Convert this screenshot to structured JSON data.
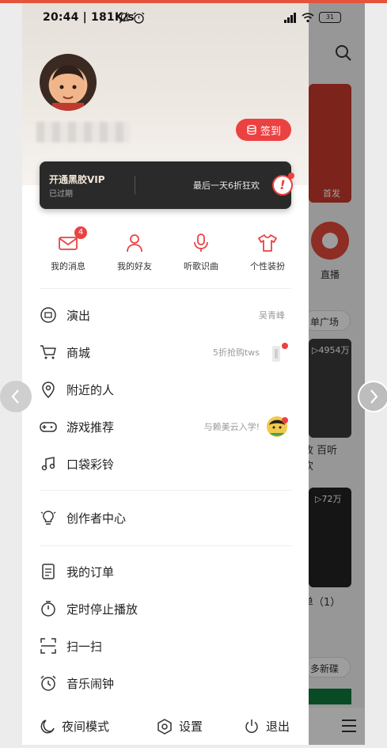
{
  "status_bar": {
    "time_speed": "20:44 | 181K/s",
    "battery": "31",
    "signal": "HD"
  },
  "profile": {
    "signin_label": "签到"
  },
  "vip": {
    "title": "开通黑胶VIP",
    "subtitle": "已过期",
    "promo": "最后一天6折狂欢",
    "badge": "!"
  },
  "quick_actions": [
    {
      "label": "我的消息",
      "icon": "mail-icon",
      "badge": "4"
    },
    {
      "label": "我的好友",
      "icon": "person-icon"
    },
    {
      "label": "听歌识曲",
      "icon": "mic-icon"
    },
    {
      "label": "个性装扮",
      "icon": "tshirt-icon"
    }
  ],
  "menu_group1": [
    {
      "label": "演出",
      "icon": "ticket-icon",
      "right": "吴青峰"
    },
    {
      "label": "商城",
      "icon": "cart-icon",
      "right": "5折抢购tws"
    },
    {
      "label": "附近的人",
      "icon": "location-icon",
      "right": ""
    },
    {
      "label": "游戏推荐",
      "icon": "gamepad-icon",
      "right": "与赖美云入学!"
    },
    {
      "label": "口袋彩铃",
      "icon": "ringtone-icon",
      "right": ""
    }
  ],
  "menu_group2": [
    {
      "label": "创作者中心",
      "icon": "bulb-icon"
    }
  ],
  "menu_group3": [
    {
      "label": "我的订单",
      "icon": "order-icon"
    },
    {
      "label": "定时停止播放",
      "icon": "timer-icon"
    },
    {
      "label": "扫一扫",
      "icon": "scan-icon"
    },
    {
      "label": "音乐闹钟",
      "icon": "alarm-icon"
    }
  ],
  "bottom": {
    "night_mode": "夜间模式",
    "settings": "设置",
    "logout": "退出"
  },
  "background_app": {
    "banner_tag": "首发",
    "live_label": "直播",
    "square_pill": "单广场",
    "card1_count": "▷4954万",
    "card1_caption_1": "故 百听",
    "card1_caption_2": "欢",
    "card2_count": "▷72万",
    "card2_caption": "单（1）",
    "new_pill": "多新碟"
  },
  "colors": {
    "accent": "#ec4141",
    "vip_bg": "#2a2a2a"
  }
}
